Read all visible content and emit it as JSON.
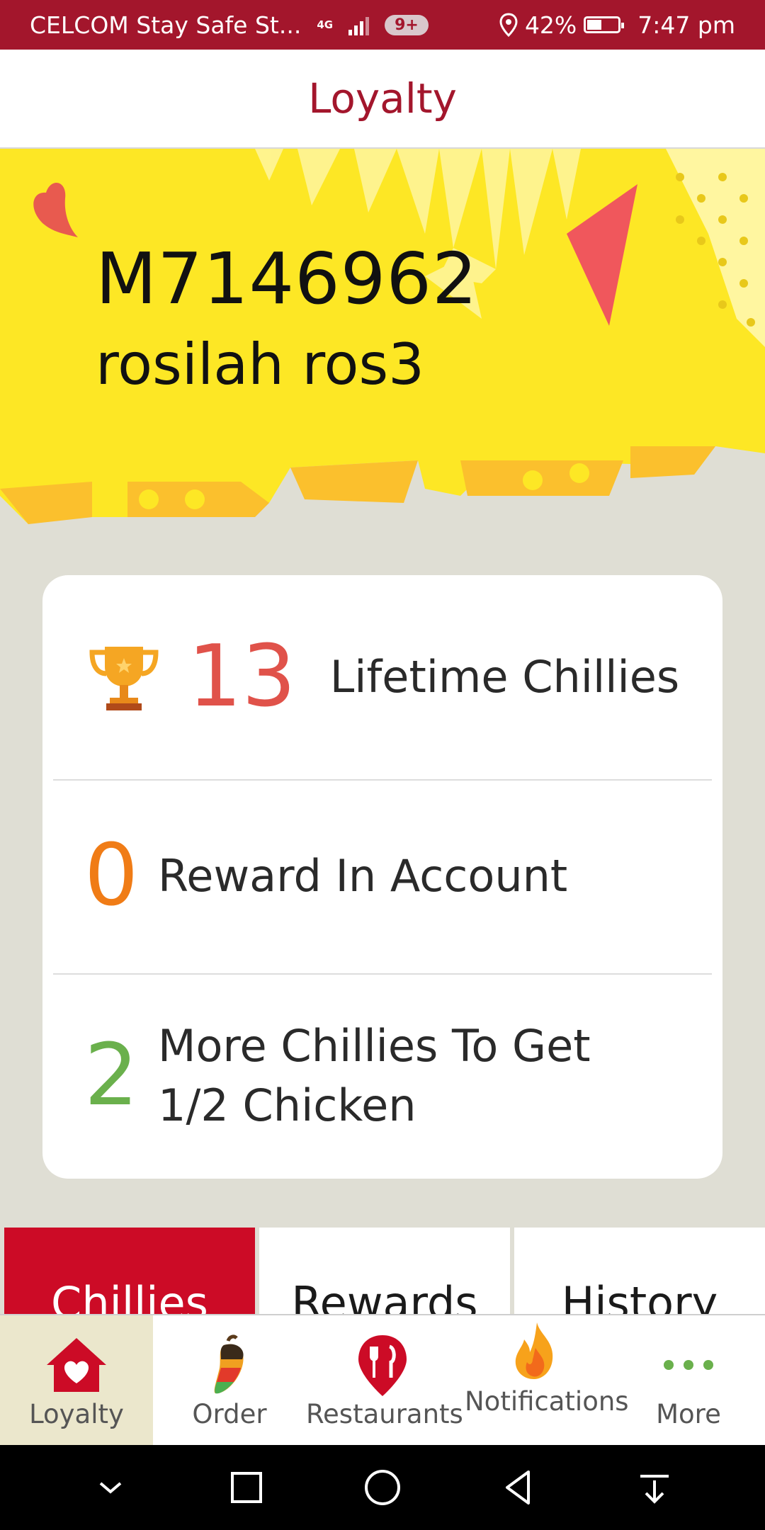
{
  "status_bar": {
    "carrier": "CELCOM Stay Safe St...",
    "network": "4G",
    "notif_count": "9+",
    "battery": "42%",
    "battery_level": 0.42,
    "time": "7:47 pm"
  },
  "header": {
    "title": "Loyalty"
  },
  "member": {
    "id": "M7146962",
    "name": "rosilah ros3"
  },
  "stats": {
    "lifetime": {
      "value": "13",
      "label": "Lifetime Chillies",
      "color": "#e0524a"
    },
    "reward": {
      "value": "0",
      "label": "Reward In Account",
      "color": "#f07c16"
    },
    "more": {
      "value": "2",
      "label": "More Chillies To Get 1/2 Chicken",
      "color": "#6ab04c"
    }
  },
  "tabs": [
    {
      "label": "Chillies",
      "active": true
    },
    {
      "label": "Rewards",
      "active": false
    },
    {
      "label": "History",
      "active": false
    }
  ],
  "bottom_nav": [
    {
      "label": "Loyalty",
      "icon": "heart-house-icon",
      "active": true
    },
    {
      "label": "Order",
      "icon": "chilli-icon",
      "active": false
    },
    {
      "label": "Restaurants",
      "icon": "location-fork-knife-icon",
      "active": false
    },
    {
      "label": "Notifications",
      "icon": "flame-icon",
      "active": false
    },
    {
      "label": "More",
      "icon": "more-dots-icon",
      "active": false
    }
  ],
  "colors": {
    "brand_red": "#a3162c",
    "tab_active": "#cc0b26",
    "banner_yellow": "#fde725"
  }
}
